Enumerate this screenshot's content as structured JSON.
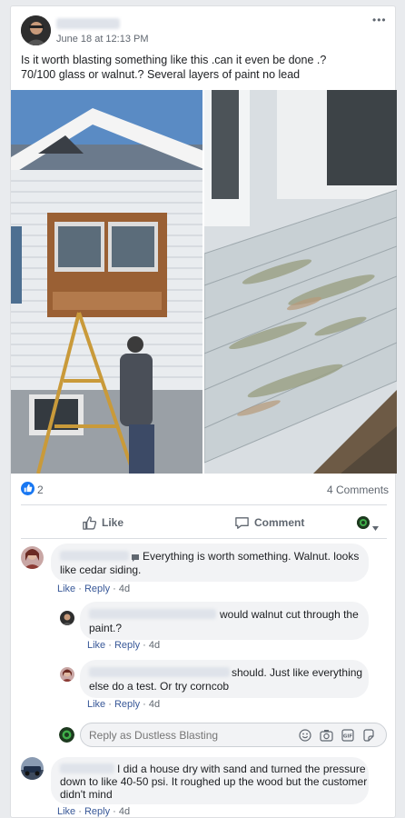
{
  "post": {
    "timestamp": "June 18 at 12:13 PM",
    "text_line1": "Is it worth blasting something like this .can it even be done .?",
    "text_line2": "70/100 glass or walnut.? Several layers of paint no lead",
    "more_label": "•••"
  },
  "reactions": {
    "count": "2",
    "comments": "4 Comments"
  },
  "actions": {
    "like": "Like",
    "comment": "Comment"
  },
  "comments": [
    {
      "line1": "Everything is worth something. Walnut. looks",
      "line2": "like cedar siding.",
      "like": "Like",
      "reply": "Reply",
      "dot": "·",
      "time": "4d"
    },
    {
      "line1": "would walnut cut through the",
      "line2": "paint.?",
      "like": "Like",
      "reply": "Reply",
      "dot": "·",
      "time": "4d"
    },
    {
      "line1": "should. Just like everything",
      "line2": "else do a test. Or try corncob",
      "like": "Like",
      "reply": "Reply",
      "dot": "·",
      "time": "4d"
    },
    {
      "line1": "I did a house dry with sand and turned the pressure",
      "line2": "down to like 40-50 psi. It roughed up the wood but the customer",
      "line3": "didn't mind",
      "like": "Like",
      "reply": "Reply",
      "dot": "·",
      "time": "4d"
    }
  ],
  "reply_box": {
    "placeholder": "Reply as Dustless Blasting"
  },
  "colors": {
    "link": "#385898",
    "like_blue": "#1877f2",
    "bubble": "#f2f3f5",
    "page_bg": "#e9ebee"
  },
  "icons": [
    "more-icon",
    "like-reaction-icon",
    "thumbs-up-icon",
    "comment-bubble-icon",
    "page-avatar-icon",
    "chevron-down-icon",
    "emoji-icon",
    "camera-icon",
    "gif-icon",
    "sticker-icon"
  ]
}
